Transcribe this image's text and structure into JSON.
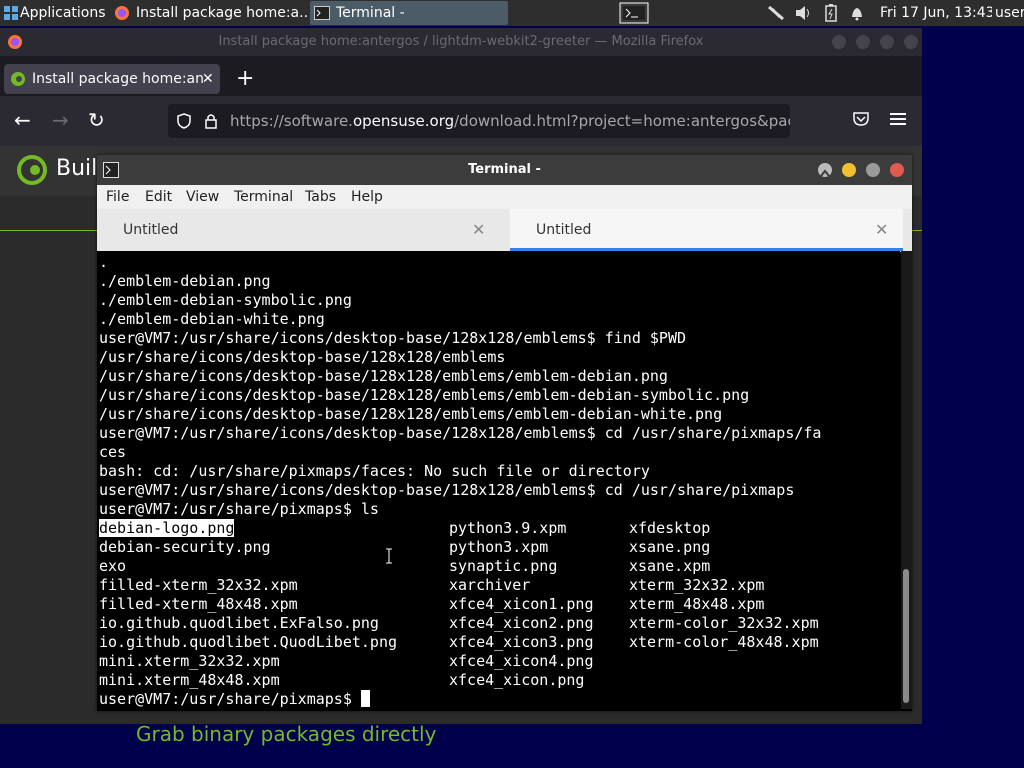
{
  "panel": {
    "applications_label": "Applications",
    "tasks": [
      {
        "label": "Install package home:a..."
      },
      {
        "label": "Terminal -"
      }
    ],
    "clock": "Fri 17 Jun, 13:43",
    "user": "user"
  },
  "firefox": {
    "window_title": "Install package home:antergos / lightdm-webkit2-greeter — Mozilla Firefox",
    "tab_title": "Install package home:an",
    "url_prefix": "https://software.",
    "url_host": "opensuse.org",
    "url_path": "/download.html?project=home:antergos&pac",
    "page_heading": "Build",
    "page_footer_text": "Grab binary packages directly"
  },
  "terminal": {
    "title": "Terminal -",
    "menu": [
      "File",
      "Edit",
      "View",
      "Terminal",
      "Tabs",
      "Help"
    ],
    "tabs": [
      {
        "label": "Untitled",
        "active": false
      },
      {
        "label": "Untitled",
        "active": true
      }
    ],
    "lines": [
      ".",
      "./emblem-debian.png",
      "./emblem-debian-symbolic.png",
      "./emblem-debian-white.png",
      "user@VM7:/usr/share/icons/desktop-base/128x128/emblems$ find $PWD",
      "/usr/share/icons/desktop-base/128x128/emblems",
      "/usr/share/icons/desktop-base/128x128/emblems/emblem-debian.png",
      "/usr/share/icons/desktop-base/128x128/emblems/emblem-debian-symbolic.png",
      "/usr/share/icons/desktop-base/128x128/emblems/emblem-debian-white.png",
      "user@VM7:/usr/share/icons/desktop-base/128x128/emblems$ cd /usr/share/pixmaps/fa",
      "ces",
      "bash: cd: /usr/share/pixmaps/faces: No such file or directory",
      "user@VM7:/usr/share/icons/desktop-base/128x128/emblems$ cd /usr/share/pixmaps",
      "user@VM7:/usr/share/pixmaps$ ls"
    ],
    "ls_columns": [
      [
        "debian-logo.png",
        "debian-security.png",
        "exo",
        "filled-xterm_32x32.xpm",
        "filled-xterm_48x48.xpm",
        "io.github.quodlibet.ExFalso.png",
        "io.github.quodlibet.QuodLibet.png",
        "mini.xterm_32x32.xpm",
        "mini.xterm_48x48.xpm"
      ],
      [
        "python3.9.xpm",
        "python3.xpm",
        "synaptic.png",
        "xarchiver",
        "xfce4_xicon1.png",
        "xfce4_xicon2.png",
        "xfce4_xicon3.png",
        "xfce4_xicon4.png",
        "xfce4_xicon.png"
      ],
      [
        "xfdesktop",
        "xsane.png",
        "xsane.xpm",
        "xterm_32x32.xpm",
        "xterm_48x48.xpm",
        "xterm-color_32x32.xpm",
        "xterm-color_48x48.xpm"
      ]
    ],
    "prompt": "user@VM7:/usr/share/pixmaps$ "
  }
}
